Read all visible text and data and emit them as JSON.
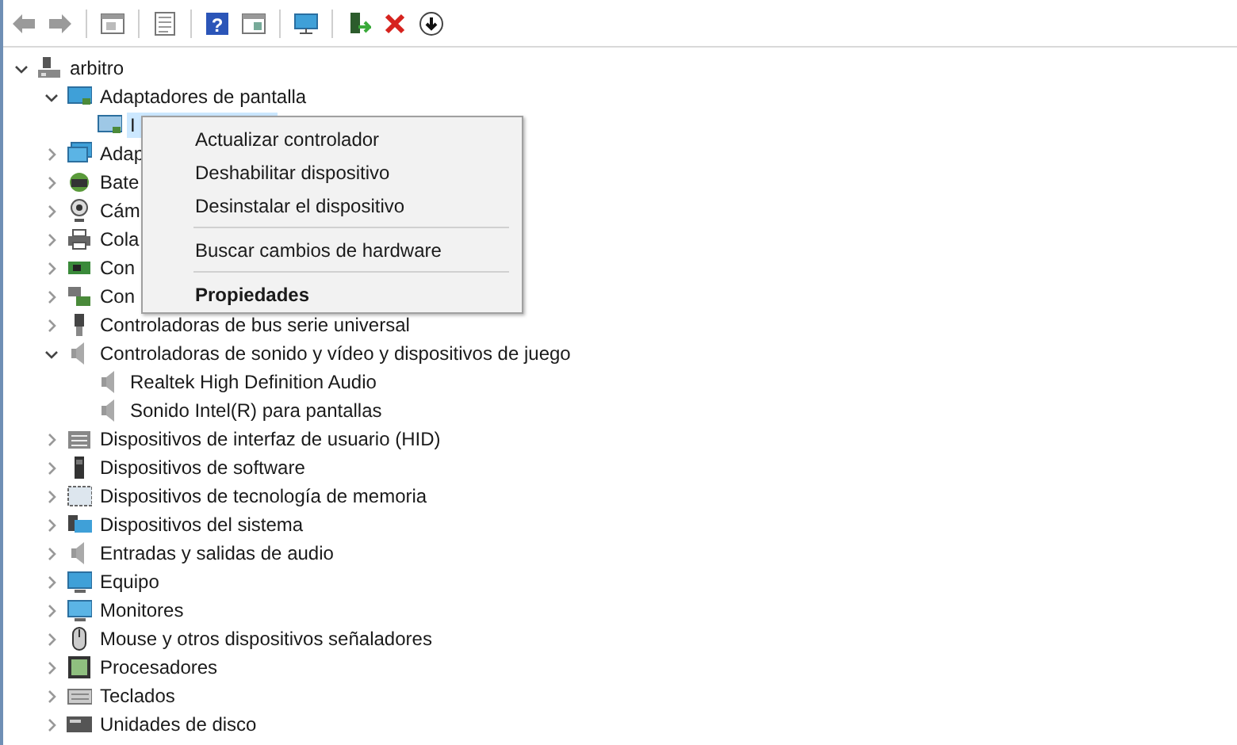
{
  "tree": {
    "label": "arbitro",
    "expanded": true,
    "selected": false,
    "children": [
      {
        "label": "Adaptadores de pantalla",
        "expanded": true,
        "selected": false,
        "children": [
          {
            "label": "I",
            "selected": true
          }
        ]
      },
      {
        "label": "Adap",
        "expanded": false,
        "selected": false
      },
      {
        "label": "Bate",
        "expanded": false,
        "selected": false
      },
      {
        "label": "Cám",
        "expanded": false,
        "selected": false
      },
      {
        "label": "Cola",
        "expanded": false,
        "selected": false
      },
      {
        "label": "Con",
        "expanded": false,
        "selected": false
      },
      {
        "label": "Con",
        "expanded": false,
        "selected": false
      },
      {
        "label": "Controladoras de bus serie universal",
        "expanded": false,
        "selected": false
      },
      {
        "label": "Controladoras de sonido y vídeo y dispositivos de juego",
        "expanded": true,
        "selected": false,
        "children": [
          {
            "label": "Realtek High Definition Audio",
            "selected": false
          },
          {
            "label": "Sonido Intel(R) para pantallas",
            "selected": false
          }
        ]
      },
      {
        "label": "Dispositivos de interfaz de usuario (HID)",
        "expanded": false,
        "selected": false
      },
      {
        "label": "Dispositivos de software",
        "expanded": false,
        "selected": false
      },
      {
        "label": "Dispositivos de tecnología de memoria",
        "expanded": false,
        "selected": false
      },
      {
        "label": "Dispositivos del sistema",
        "expanded": false,
        "selected": false
      },
      {
        "label": "Entradas y salidas de audio",
        "expanded": false,
        "selected": false
      },
      {
        "label": "Equipo",
        "expanded": false,
        "selected": false
      },
      {
        "label": "Monitores",
        "expanded": false,
        "selected": false
      },
      {
        "label": "Mouse y otros dispositivos señaladores",
        "expanded": false,
        "selected": false
      },
      {
        "label": "Procesadores",
        "expanded": false,
        "selected": false
      },
      {
        "label": "Teclados",
        "expanded": false,
        "selected": false
      },
      {
        "label": "Unidades de disco",
        "expanded": false,
        "selected": false
      }
    ]
  },
  "toolbar": {
    "help_symbol": "?"
  },
  "context_menu": [
    {
      "kind": "item",
      "label": "Actualizar controlador",
      "bold": false
    },
    {
      "kind": "item",
      "label": "Deshabilitar dispositivo",
      "bold": false
    },
    {
      "kind": "item",
      "label": "Desinstalar el dispositivo",
      "bold": false
    },
    {
      "kind": "separator"
    },
    {
      "kind": "item",
      "label": "Buscar cambios de hardware",
      "bold": false
    },
    {
      "kind": "separator"
    },
    {
      "kind": "item",
      "label": "Propiedades",
      "bold": true
    }
  ]
}
